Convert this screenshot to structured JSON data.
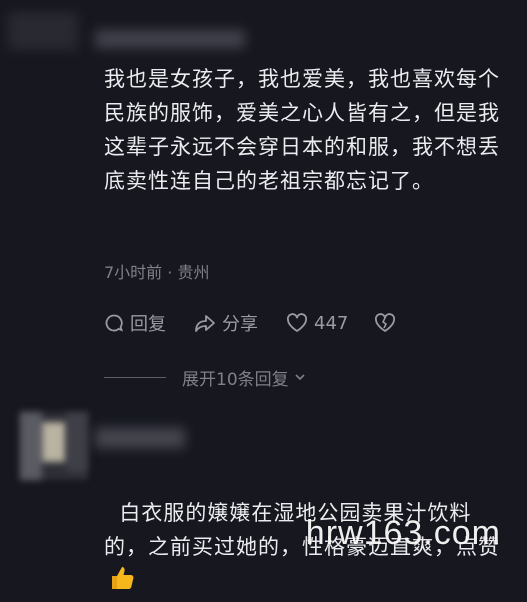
{
  "comment1": {
    "text": "我也是女孩子，我也爱美，我也喜欢每个民族的服饰，爱美之心人皆有之，但是我这辈子永远不会穿日本的和服，我不想丢底卖性连自己的老祖宗都忘记了。",
    "meta": "7小时前 · 贵州",
    "actions": {
      "reply_label": "回复",
      "share_label": "分享",
      "like_count": "447"
    },
    "expand_label": "展开10条回复"
  },
  "comment2": {
    "text": "白衣服的嬢嬢在湿地公园卖果汁饮料的，之前买过她的，性格豪迈直爽，点赞"
  },
  "watermark": "hrw163.com",
  "colors": {
    "background": "#16171f",
    "text": "#ececf0",
    "muted": "#7f8088",
    "thumb": "#f5b71c"
  },
  "icons": [
    "reply-bubble-icon",
    "share-arrow-icon",
    "heart-icon",
    "broken-heart-icon",
    "chevron-down-icon",
    "thumbs-up-emoji"
  ]
}
